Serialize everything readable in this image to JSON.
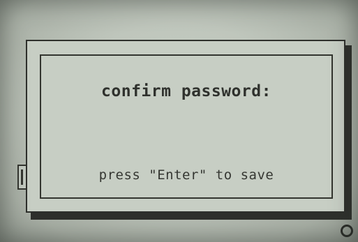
{
  "dialog": {
    "title": "confirm password:",
    "hint": "press \"Enter\" to save",
    "scroll_indicator": "1"
  },
  "icons": {
    "corner": "circle-icon"
  },
  "colors": {
    "lcd_background": "#bfc6bc",
    "lcd_ink": "#2f312d"
  }
}
